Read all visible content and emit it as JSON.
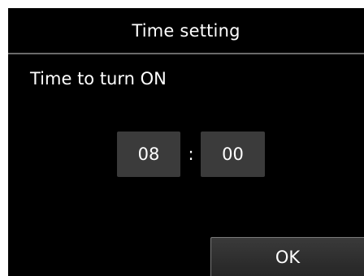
{
  "header": {
    "title": "Time setting"
  },
  "prompt": {
    "label": "Time to turn ON"
  },
  "time": {
    "hours": "08",
    "separator": ":",
    "minutes": "00"
  },
  "actions": {
    "ok_label": "OK"
  },
  "colors": {
    "background": "#000000",
    "text": "#ffffff",
    "field": "#3b3b3b",
    "divider": "#6a6a6a"
  }
}
